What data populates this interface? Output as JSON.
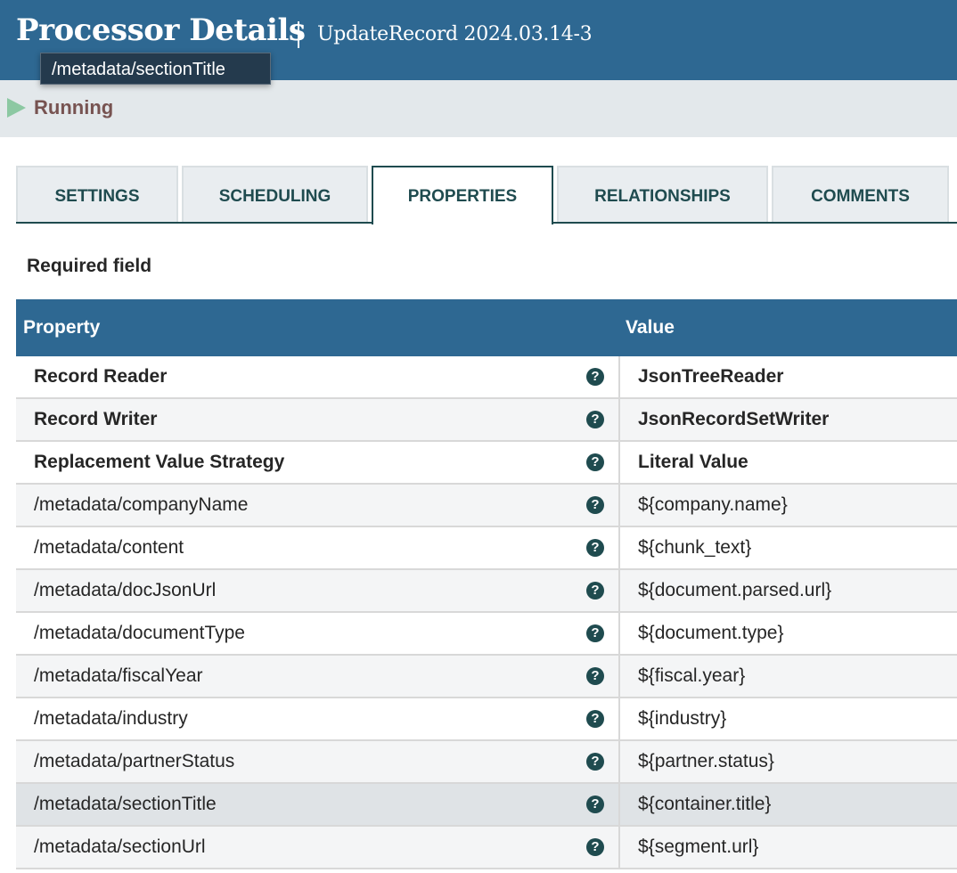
{
  "header": {
    "title": "Processor Details",
    "subtitle": "UpdateRecord 2024.03.14-3"
  },
  "tooltip": {
    "text": "/metadata/sectionTitle"
  },
  "status": {
    "icon": "play-icon",
    "label": "Running",
    "color": "#8cc8a2"
  },
  "tabs": [
    {
      "label": "SETTINGS",
      "active": false
    },
    {
      "label": "SCHEDULING",
      "active": false
    },
    {
      "label": "PROPERTIES",
      "active": true
    },
    {
      "label": "RELATIONSHIPS",
      "active": false
    },
    {
      "label": "COMMENTS",
      "active": false
    }
  ],
  "required_label": "Required field",
  "table": {
    "columns": [
      "Property",
      "Value"
    ],
    "rows": [
      {
        "name": "Record Reader",
        "value": "JsonTreeReader",
        "required": true,
        "help_icon": "?"
      },
      {
        "name": "Record Writer",
        "value": "JsonRecordSetWriter",
        "required": true,
        "help_icon": "?"
      },
      {
        "name": "Replacement Value Strategy",
        "value": "Literal Value",
        "required": true,
        "help_icon": "?"
      },
      {
        "name": "/metadata/companyName",
        "value": "${company.name}",
        "required": false,
        "help_icon": "?"
      },
      {
        "name": "/metadata/content",
        "value": "${chunk_text}",
        "required": false,
        "help_icon": "?"
      },
      {
        "name": "/metadata/docJsonUrl",
        "value": "${document.parsed.url}",
        "required": false,
        "help_icon": "?"
      },
      {
        "name": "/metadata/documentType",
        "value": "${document.type}",
        "required": false,
        "help_icon": "?"
      },
      {
        "name": "/metadata/fiscalYear",
        "value": "${fiscal.year}",
        "required": false,
        "help_icon": "?"
      },
      {
        "name": "/metadata/industry",
        "value": "${industry}",
        "required": false,
        "help_icon": "?"
      },
      {
        "name": "/metadata/partnerStatus",
        "value": "${partner.status}",
        "required": false,
        "help_icon": "?"
      },
      {
        "name": "/metadata/sectionTitle",
        "value": "${container.title}",
        "required": false,
        "help_icon": "?",
        "hovered": true
      },
      {
        "name": "/metadata/sectionUrl",
        "value": "${segment.url}",
        "required": false,
        "help_icon": "?"
      }
    ]
  },
  "colors": {
    "header_bg": "#2e6892",
    "accent": "#1f4b4f",
    "status_text": "#775351"
  }
}
